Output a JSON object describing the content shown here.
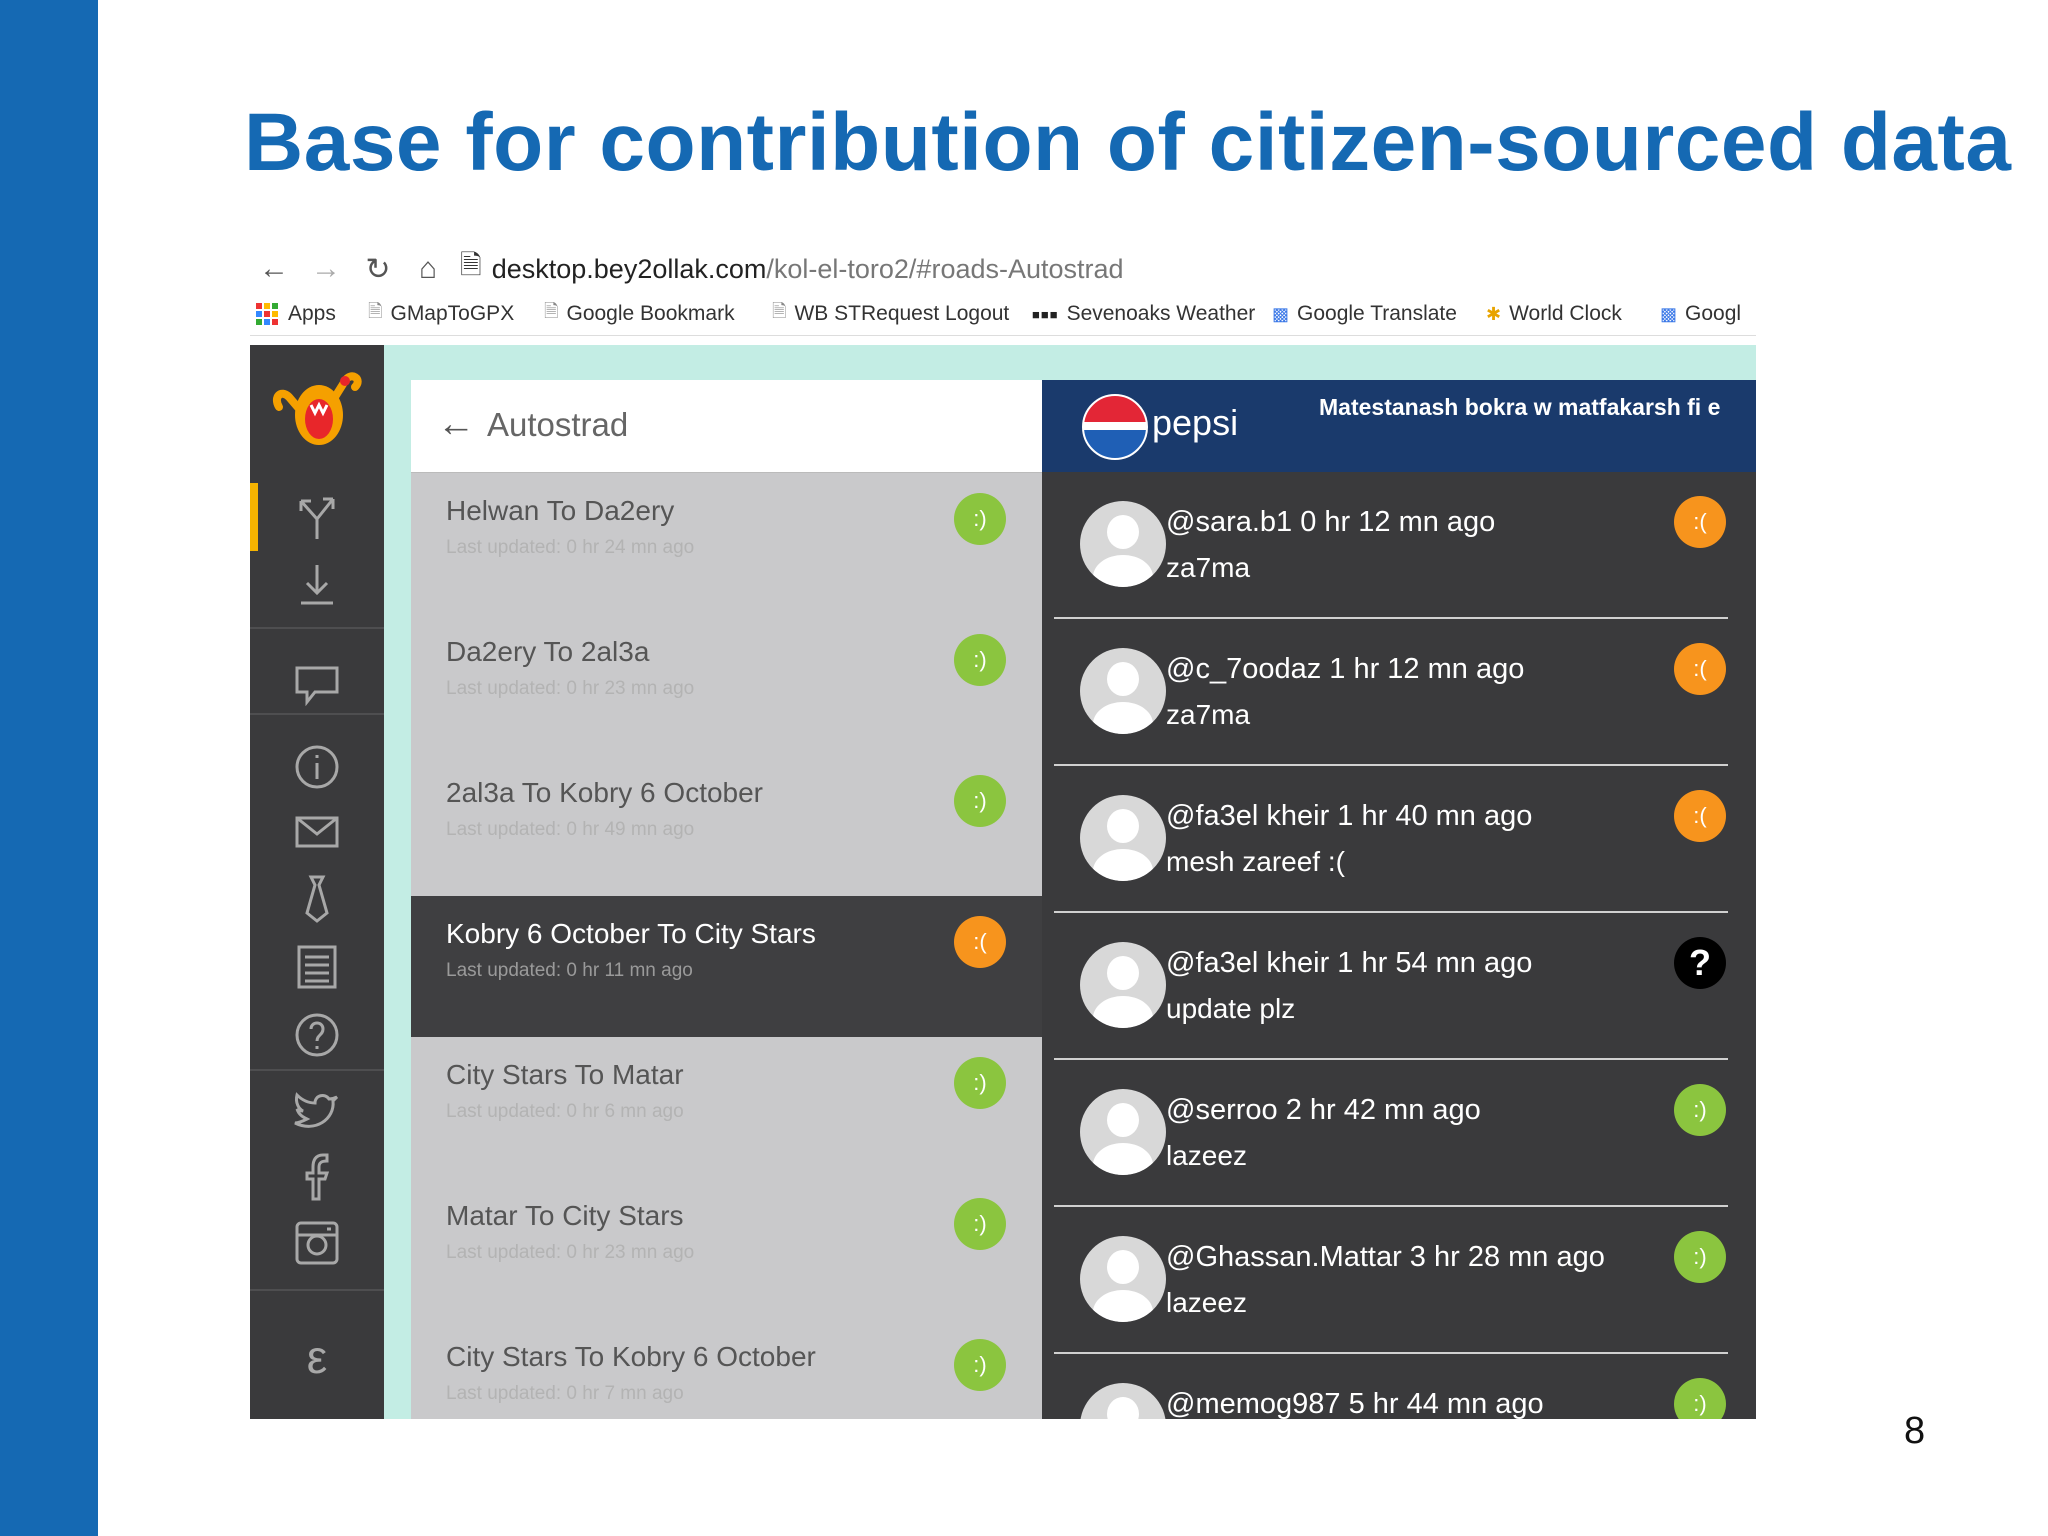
{
  "slide": {
    "title": "Base for contribution of citizen-sourced data",
    "page_number": "8"
  },
  "browser": {
    "url_domain": "desktop.bey2ollak.com",
    "url_path": "/kol-el-toro2/#roads-Autostrad",
    "bookmarks": [
      {
        "label": "Apps",
        "icon": "apps-grid-icon"
      },
      {
        "label": "GMapToGPX",
        "icon": "page-icon"
      },
      {
        "label": "Google Bookmark",
        "icon": "page-icon"
      },
      {
        "label": "WB STRequest Logout",
        "icon": "page-icon"
      },
      {
        "label": "Sevenoaks Weather",
        "icon": "bbc-icon"
      },
      {
        "label": "Google Translate",
        "icon": "translate-icon"
      },
      {
        "label": "World Clock",
        "icon": "clock-icon"
      },
      {
        "label": "Googl",
        "icon": "translate-icon"
      }
    ]
  },
  "roads": {
    "title": "Autostrad",
    "items": [
      {
        "name": "Helwan To Da2ery",
        "updated": "Last updated: 0 hr 24 mn ago",
        "status": ":)",
        "status_color": "#8bc53f"
      },
      {
        "name": "Da2ery To 2al3a",
        "updated": "Last updated: 0 hr 23 mn ago",
        "status": ":)",
        "status_color": "#8bc53f"
      },
      {
        "name": "2al3a To Kobry 6 October",
        "updated": "Last updated: 0 hr 49 mn ago",
        "status": ":)",
        "status_color": "#8bc53f"
      },
      {
        "name": "Kobry 6 October To City Stars",
        "updated": "Last updated: 0 hr 11 mn ago",
        "status": ":(",
        "status_color": "#f7941d",
        "active": true
      },
      {
        "name": "City Stars To Matar",
        "updated": "Last updated: 0 hr 6 mn ago",
        "status": ":)",
        "status_color": "#8bc53f"
      },
      {
        "name": "Matar To City Stars",
        "updated": "Last updated: 0 hr 23 mn ago",
        "status": ":)",
        "status_color": "#8bc53f"
      },
      {
        "name": "City Stars To Kobry 6 October",
        "updated": "Last updated: 0 hr 7 mn ago",
        "status": ":)",
        "status_color": "#8bc53f"
      }
    ]
  },
  "ad": {
    "brand": "pepsi",
    "text": "Matestanash bokra w matfakarsh fi e"
  },
  "feed": [
    {
      "user": "@sara.b1 0 hr 12 mn ago",
      "message": "za7ma",
      "status": ":(",
      "status_color": "#f7941d"
    },
    {
      "user": "@c_7oodaz 1 hr 12 mn ago",
      "message": "za7ma",
      "status": ":(",
      "status_color": "#f7941d"
    },
    {
      "user": "@fa3el kheir 1 hr 40 mn ago",
      "message": "mesh zareef :(",
      "status": ":(",
      "status_color": "#f7941d"
    },
    {
      "user": "@fa3el kheir 1 hr 54 mn ago",
      "message": "update plz",
      "status": "?",
      "status_color": "#000000"
    },
    {
      "user": "@serroo 2 hr 42 mn ago",
      "message": "lazeez",
      "status": ":)",
      "status_color": "#8bc53f"
    },
    {
      "user": "@Ghassan.Mattar 3 hr 28 mn ago",
      "message": "lazeez",
      "status": ":)",
      "status_color": "#8bc53f"
    },
    {
      "user": "@memog987 5 hr 44 mn ago",
      "message": "",
      "status": ":)",
      "status_color": "#8bc53f"
    }
  ],
  "colors": {
    "brand_blue": "#1569b3",
    "rail_accent": "#f5b301",
    "mint_bg": "#c3ede4"
  },
  "rail_icons": [
    "app-logo-icon",
    "fork-road-icon",
    "download-icon",
    "chat-icon",
    "info-icon",
    "mail-icon",
    "tie-icon",
    "list-icon",
    "help-icon",
    "twitter-icon",
    "facebook-icon",
    "instagram-icon",
    "language-icon"
  ]
}
